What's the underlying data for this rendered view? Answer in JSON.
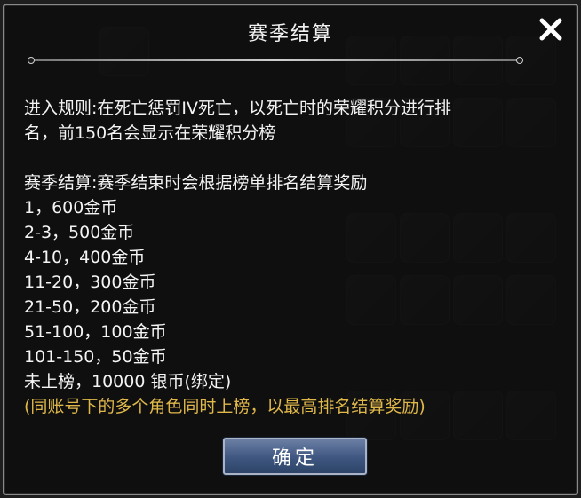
{
  "dialog": {
    "title": "赛季结算",
    "close_icon": "close-icon",
    "rules_line1": "进入规则:在死亡惩罚IV死亡，以死亡时的荣耀积分进行排",
    "rules_line2": "名，前150名会显示在荣耀积分榜",
    "settlement_title": "赛季结算:赛季结束时会根据榜单排名结算奖励",
    "rewards": [
      "1，600金币",
      "2-3，500金币",
      "4-10，400金币",
      "11-20，300金币",
      "21-50，200金币",
      "51-100，100金币",
      "101-150，50金币",
      "未上榜，10000 银币(绑定)"
    ],
    "note": "(同账号下的多个角色同时上榜，以最高排名结算奖励)",
    "confirm_label": "确定"
  },
  "colors": {
    "note": "#e0b84a",
    "button": "#3e5680",
    "text": "#f4f4f4"
  }
}
